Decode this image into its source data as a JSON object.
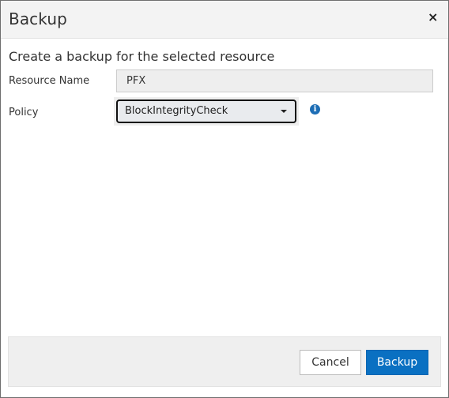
{
  "dialog": {
    "title": "Backup",
    "close_symbol": "×",
    "subtitle": "Create a backup for the selected resource"
  },
  "form": {
    "resource_name_label": "Resource Name",
    "resource_name_value": "PFX",
    "policy_label": "Policy",
    "policy_selected": "BlockIntegrityCheck",
    "info_symbol": "i"
  },
  "footer": {
    "cancel_label": "Cancel",
    "backup_label": "Backup"
  },
  "colors": {
    "primary_button": "#0a70c2",
    "info_icon": "#1c6db5",
    "header_background": "#f3f3f3"
  },
  "icons": {
    "close": "close-icon",
    "dropdown": "chevron-down-icon",
    "info": "info-icon"
  }
}
